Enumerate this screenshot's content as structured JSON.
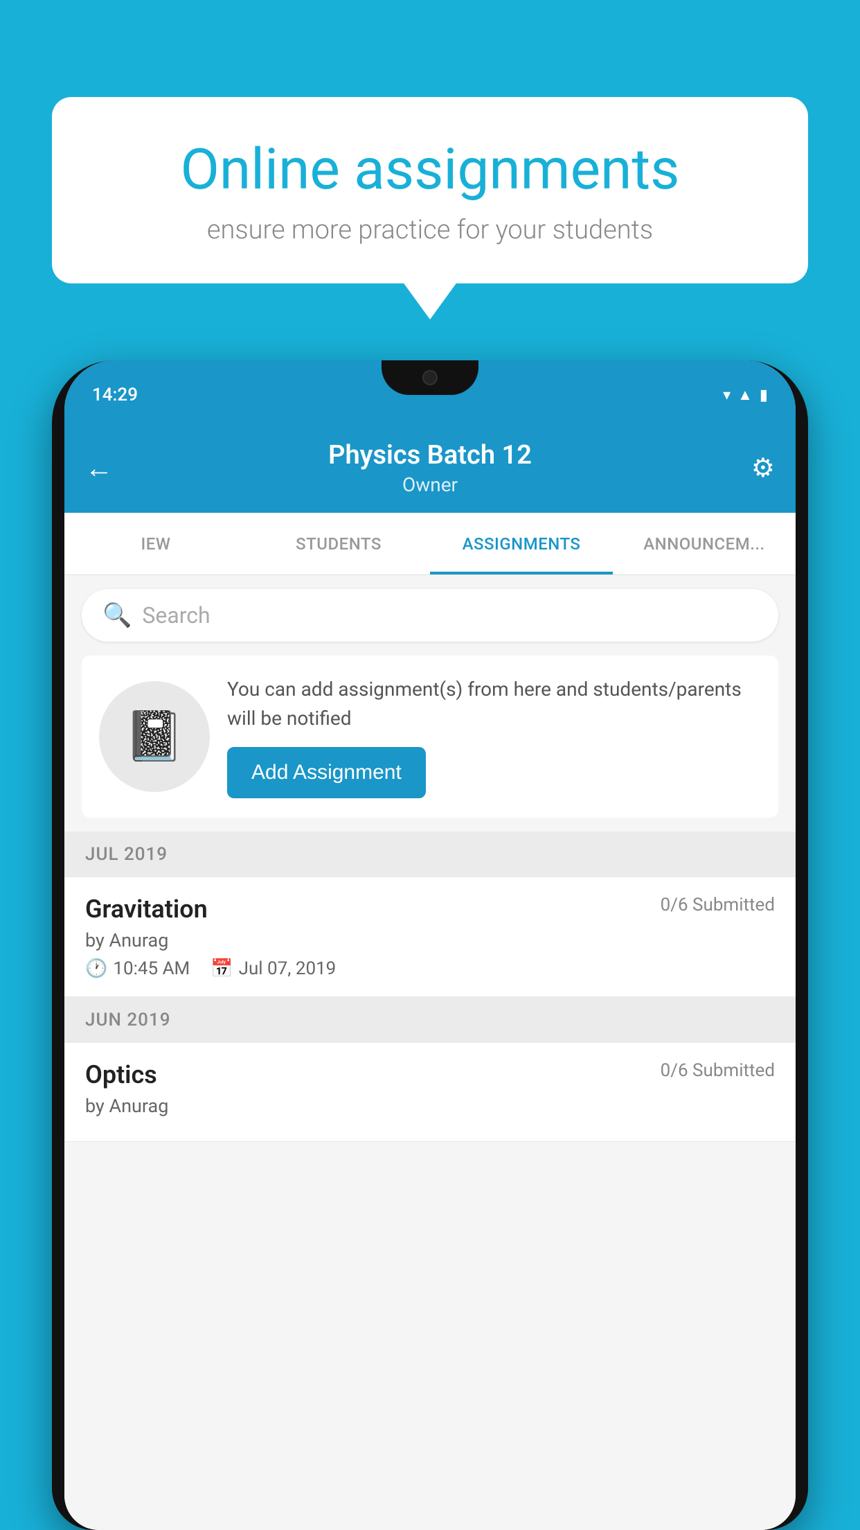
{
  "background_color": "#19b0d8",
  "speech_bubble": {
    "title": "Online assignments",
    "subtitle": "ensure more practice for your students"
  },
  "phone": {
    "status_bar": {
      "time": "14:29",
      "icons": [
        "wifi",
        "signal",
        "battery"
      ]
    },
    "header": {
      "title": "Physics Batch 12",
      "subtitle": "Owner",
      "back_label": "←",
      "gear_label": "⚙"
    },
    "tabs": [
      {
        "label": "IEW",
        "active": false
      },
      {
        "label": "STUDENTS",
        "active": false
      },
      {
        "label": "ASSIGNMENTS",
        "active": true
      },
      {
        "label": "ANNOUNCEM...",
        "active": false
      }
    ],
    "search": {
      "placeholder": "Search"
    },
    "promo": {
      "description": "You can add assignment(s) from here and students/parents will be notified",
      "button_label": "Add Assignment"
    },
    "sections": [
      {
        "month_label": "JUL 2019",
        "assignments": [
          {
            "name": "Gravitation",
            "submitted": "0/6 Submitted",
            "author": "by Anurag",
            "time": "10:45 AM",
            "date": "Jul 07, 2019"
          }
        ]
      },
      {
        "month_label": "JUN 2019",
        "assignments": [
          {
            "name": "Optics",
            "submitted": "0/6 Submitted",
            "author": "by Anurag",
            "time": "",
            "date": ""
          }
        ]
      }
    ]
  }
}
